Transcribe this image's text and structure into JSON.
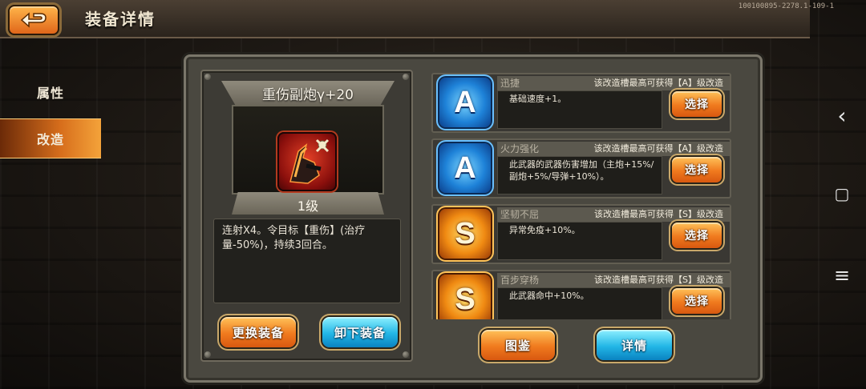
{
  "header": {
    "title": "装备详情",
    "version": "100100895-2278.1-109-1"
  },
  "sidebar": {
    "items": [
      {
        "label": "属性"
      },
      {
        "label": "改造"
      }
    ]
  },
  "equipment": {
    "name": "重伤副炮γ+20",
    "level": "1级",
    "description": "连射X4。令目标【重伤】(治疗量-50%)，持续3回合。"
  },
  "actions": {
    "replace_label": "更换装备",
    "unequip_label": "卸下装备",
    "codex_label": "图鉴",
    "details_label": "详情"
  },
  "slots": [
    {
      "grade": "A",
      "name": "迅捷",
      "hint": "该改造槽最高可获得【A】级改造",
      "effect": "基础速度+1。",
      "button": "选择"
    },
    {
      "grade": "A",
      "name": "火力强化",
      "hint": "该改造槽最高可获得【A】级改造",
      "effect": "此武器的武器伤害增加（主炮+15%/副炮+5%/导弹+10%）。",
      "button": "选择"
    },
    {
      "grade": "S",
      "name": "坚韧不屈",
      "hint": "该改造槽最高可获得【S】级改造",
      "effect": "异常免疫+10%。",
      "button": "选择"
    },
    {
      "grade": "S",
      "name": "百步穿杨",
      "hint": "该改造槽最高可获得【S】级改造",
      "effect": "此武器命中+10%。",
      "button": "选择"
    }
  ],
  "system_nav": {
    "back_icon": "‹",
    "home_icon": "▢",
    "menu_icon": "≡"
  },
  "colors": {
    "accent_orange": "#f07a1e",
    "accent_blue": "#22b6e6",
    "grade_a": "#1e82d8",
    "grade_s": "#f08a12"
  }
}
